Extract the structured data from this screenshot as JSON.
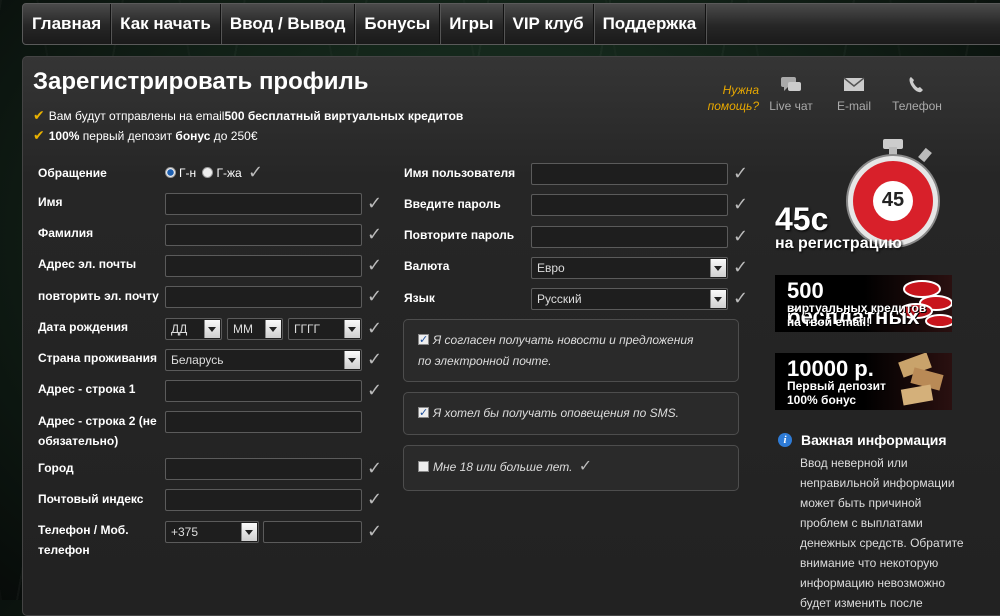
{
  "nav": [
    "Главная",
    "Как начать",
    "Ввод / Вывод",
    "Бонусы",
    "Игры",
    "VIP клуб",
    "Поддержка"
  ],
  "page_title": "Зарегистрировать профиль",
  "benefits": [
    {
      "pre": "Вам будут отправлены на email ",
      "bold": "500 бесплатный виртуальных кредитов",
      "post": ""
    },
    {
      "pre": "",
      "bold": "100%",
      "post": " первый депозит ",
      "bold2": "бонус",
      "post2": " до 250€"
    }
  ],
  "help": {
    "line1": "Нужна",
    "line2": "помощь?"
  },
  "contacts": [
    {
      "label": "Live чат",
      "icon": "chat-icon"
    },
    {
      "label": "E-mail",
      "icon": "envelope-icon"
    },
    {
      "label": "Телефон",
      "icon": "phone-icon"
    }
  ],
  "form_left": {
    "salutation_label": "Обращение",
    "salutation_mr": "Г-н",
    "salutation_mrs": "Г-жа",
    "first_name": "Имя",
    "last_name": "Фамилия",
    "email": "Адрес эл. почты",
    "email_repeat": "повторить эл. почту",
    "dob": "Дата рождения",
    "dob_day": "ДД",
    "dob_month": "ММ",
    "dob_year": "ГГГГ",
    "country": "Страна проживания",
    "country_value": "Беларусь",
    "address1": "Адрес - строка 1",
    "address2_line1": "Адрес - строка 2 (не",
    "address2_line2": "обязательно)",
    "city": "Город",
    "postcode": "Почтовый индекс",
    "phone_line1": "Телефон / Моб.",
    "phone_line2": "телефон",
    "phone_code": "+375"
  },
  "form_right": {
    "username": "Имя пользователя",
    "password": "Введите пароль",
    "password_repeat": "Повторите пароль",
    "currency": "Валюта",
    "currency_value": "Евро",
    "language": "Язык",
    "language_value": "Русский"
  },
  "options": {
    "news_line1": "Я согласен получать новости и предложения",
    "news_line2": "по электронной почте.",
    "sms": "Я хотел бы получать оповещения по SMS.",
    "age": "Мне 18 или больше лет."
  },
  "promo": {
    "timer_value": "45",
    "timer_head": "45с",
    "timer_sub": "на регистрацию",
    "bonus1_big": "500 бесплатных",
    "bonus1_small1": "виртуальных кредитов",
    "bonus1_small2": "на твой email!",
    "bonus2_big": "10000 р.",
    "bonus2_small1": "Первый депозит",
    "bonus2_small2": "100% бонус"
  },
  "info": {
    "title": "Важная информация",
    "lines": [
      "Ввод неверной или",
      "неправильной информации",
      "может быть причиной",
      "проблем с выплатами",
      "денежных средств. Обратите",
      "внимание что некоторую",
      "информацию невозможно",
      "будет изменить после"
    ]
  },
  "colors": {
    "accent": "#e8b100",
    "help": "#e8a800",
    "timer_red": "#d8202a"
  }
}
